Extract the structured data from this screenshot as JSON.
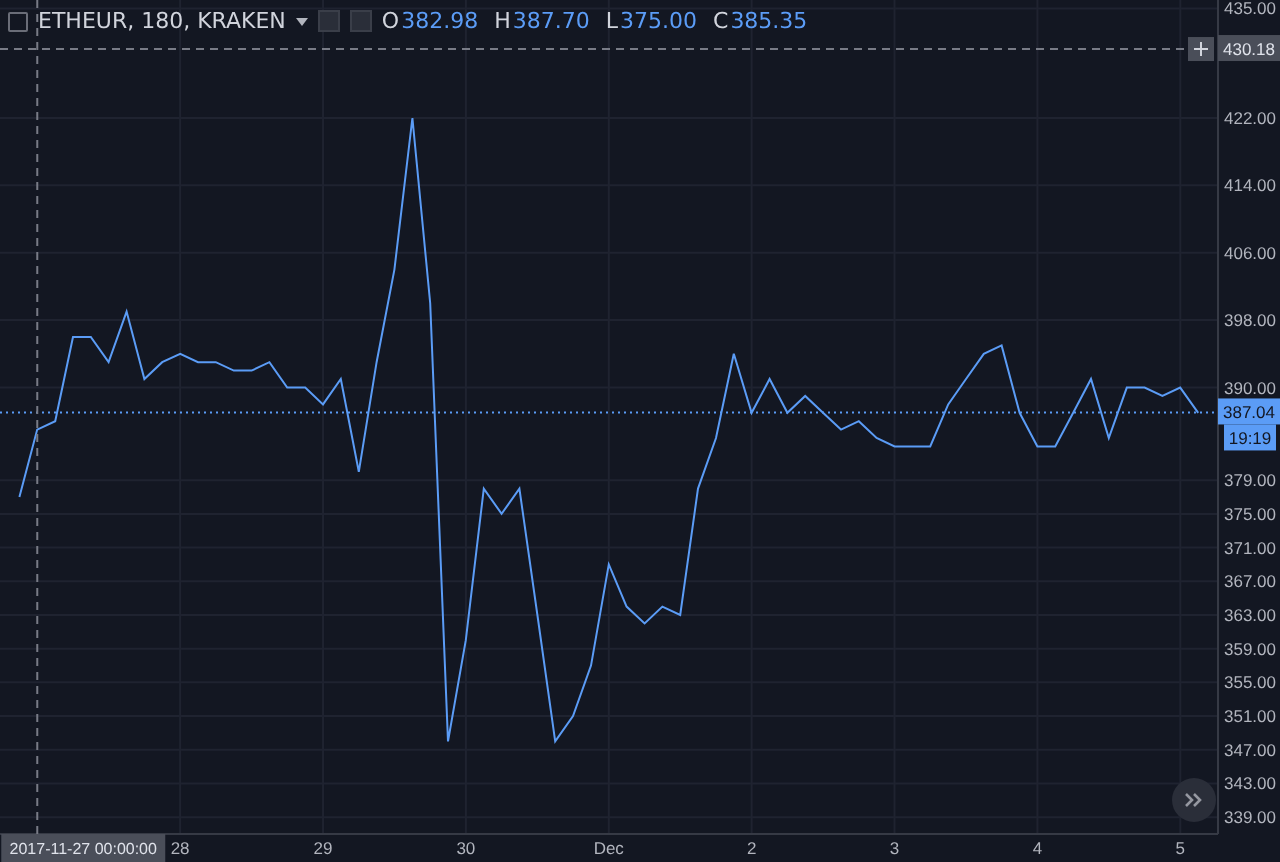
{
  "legend": {
    "symbol": "ETHEUR, 180, KRAKEN",
    "ohlc": [
      {
        "label": "O",
        "value": "382.98"
      },
      {
        "label": "H",
        "value": "387.70"
      },
      {
        "label": "L",
        "value": "375.00"
      },
      {
        "label": "C",
        "value": "385.35"
      }
    ]
  },
  "chart_data": {
    "type": "line",
    "grid": true,
    "ylim": [
      337,
      436
    ],
    "yticks": [
      {
        "value": 435,
        "label": "435.00"
      },
      {
        "value": 422,
        "label": "422.00"
      },
      {
        "value": 414,
        "label": "414.00"
      },
      {
        "value": 406,
        "label": "406.00"
      },
      {
        "value": 398,
        "label": "398.00"
      },
      {
        "value": 390,
        "label": "390.00"
      },
      {
        "value": 379,
        "label": "379.00"
      },
      {
        "value": 375,
        "label": "375.00"
      },
      {
        "value": 371,
        "label": "371.00"
      },
      {
        "value": 367,
        "label": "367.00"
      },
      {
        "value": 363,
        "label": "363.00"
      },
      {
        "value": 359,
        "label": "359.00"
      },
      {
        "value": 355,
        "label": "355.00"
      },
      {
        "value": 351,
        "label": "351.00"
      },
      {
        "value": 347,
        "label": "347.00"
      },
      {
        "value": 343,
        "label": "343.00"
      },
      {
        "value": 339,
        "label": "339.00"
      }
    ],
    "categories": [
      null,
      null,
      null,
      null,
      null,
      null,
      null,
      null,
      null,
      "28",
      null,
      null,
      null,
      null,
      null,
      null,
      null,
      "29",
      null,
      null,
      null,
      null,
      null,
      null,
      null,
      "30",
      null,
      null,
      null,
      null,
      null,
      null,
      null,
      "Dec",
      null,
      null,
      null,
      null,
      null,
      null,
      null,
      "2",
      null,
      null,
      null,
      null,
      null,
      null,
      null,
      "3",
      null,
      null,
      null,
      null,
      null,
      null,
      null,
      "4",
      null,
      null,
      null,
      null,
      null,
      null,
      null,
      "5",
      null
    ],
    "series": [
      {
        "color": "#5b9cf6",
        "values": [
          377,
          385,
          386,
          396,
          396,
          393,
          399,
          391,
          393,
          394,
          393,
          393,
          392,
          392,
          393,
          390,
          390,
          388,
          391,
          380,
          393,
          404,
          422,
          400,
          348,
          360,
          378,
          375,
          378,
          363,
          348,
          351,
          357,
          369,
          364,
          362,
          364,
          363,
          378,
          384,
          394,
          387,
          391,
          387,
          389,
          387,
          385,
          386,
          384,
          383,
          383,
          383,
          388,
          391,
          394,
          395,
          387,
          383,
          383,
          387,
          391,
          384,
          390,
          390,
          389,
          390,
          387
        ]
      }
    ],
    "ref_lines": [
      {
        "axis": "y",
        "value": 430.18,
        "label": "430.18",
        "color": "#787b86"
      },
      {
        "axis": "y",
        "value": 387.04,
        "label": "387.04",
        "color": "#5b9cf6"
      }
    ]
  },
  "crosshair": {
    "time": "2017-11-27 00:00:00"
  },
  "countdown": "19:19"
}
